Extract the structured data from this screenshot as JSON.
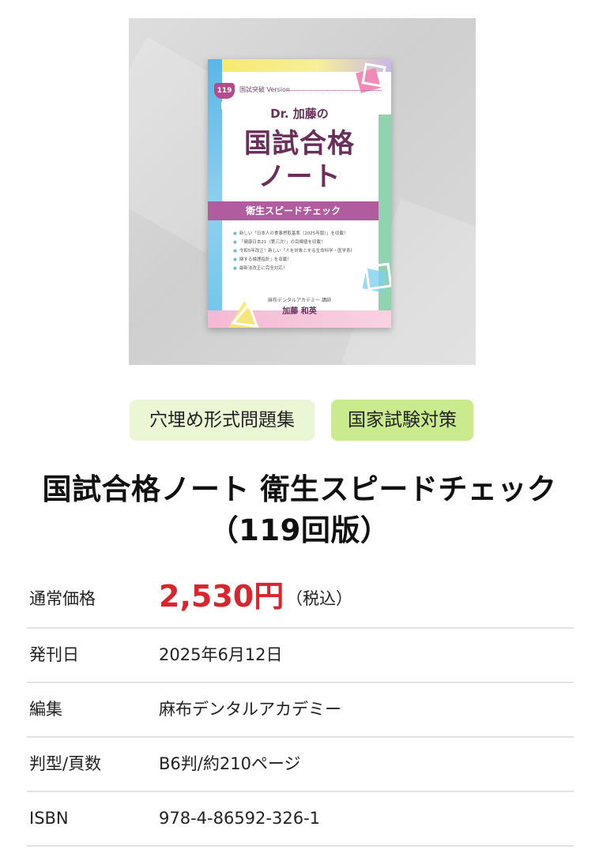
{
  "product_image": {
    "badge": "119回",
    "version_label": "国試突破 Version",
    "author_title": "Dr. 加藤の",
    "main_title_line1": "国試合格",
    "main_title_line2": "ノート",
    "subtitle_band": "衛生スピードチェック",
    "bullets": [
      "新しい「日本人の食事摂取基準（2025年版）」を収載！",
      "「健康日本21（第三次）」の目標値を収載！",
      "令和5年改正！新しい「人を対象とする生命科学・医学系研究に",
      "関する倫理指針」を収載！",
      "最新法改正に完全対応！"
    ],
    "publisher_line": "麻布デンタルアカデミー 講師",
    "author_name": "加藤 和英"
  },
  "tags": [
    "穴埋め形式問題集",
    "国家試験対策"
  ],
  "product_title": "国試合格ノート 衛生スピードチェック（119回版）",
  "price": {
    "label": "通常価格",
    "value": "2,530円",
    "tax_note": "（税込）",
    "color": "#d7262d"
  },
  "specs": [
    {
      "label": "発刊日",
      "value": "2025年6月12日"
    },
    {
      "label": "編集",
      "value": "麻布デンタルアカデミー"
    },
    {
      "label": "判型/頁数",
      "value": "B6判/約210ページ"
    },
    {
      "label": "ISBN",
      "value": "978-4-86592-326-1"
    }
  ],
  "colors": {
    "tag1_bg": "#eaf6d4",
    "tag2_bg": "#c9eb8e",
    "divider": "#e3e3e3"
  }
}
